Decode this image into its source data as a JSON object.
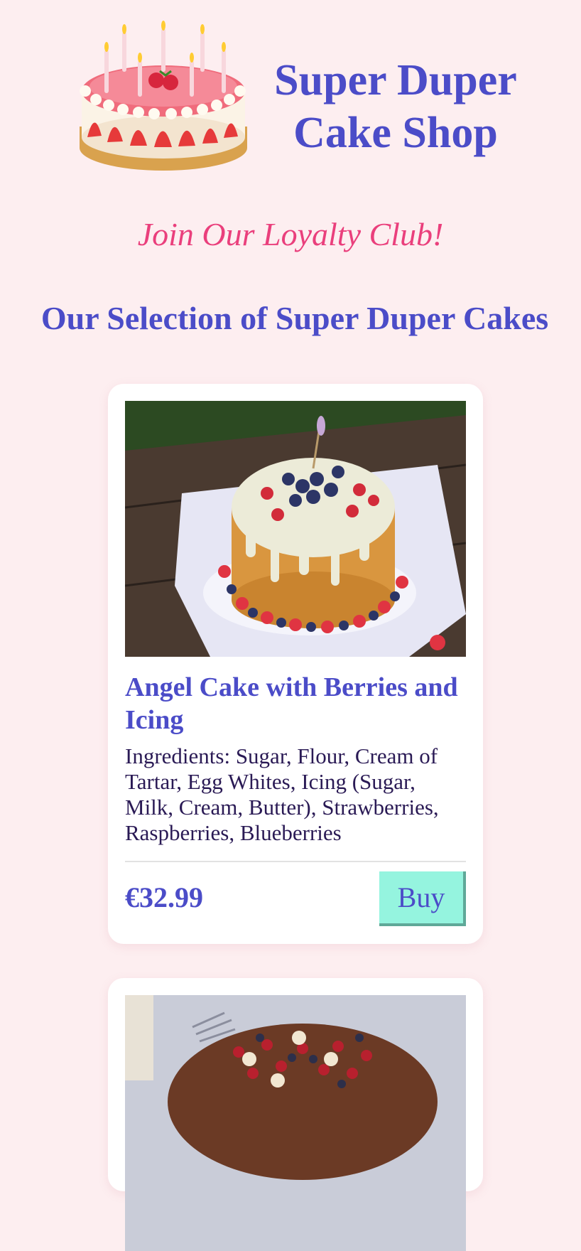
{
  "header": {
    "logo_icon": "birthday-cake-icon",
    "title": "Super Duper Cake Shop"
  },
  "loyalty_link": "Join Our Loyalty Club!",
  "section_title": "Our Selection of Super Duper Cakes",
  "products": [
    {
      "image": "angel-cake-photo",
      "name": "Angel Cake with Berries and Icing",
      "ingredients": "Ingredients: Sugar, Flour, Cream of Tartar, Egg Whites, Icing (Sugar, Milk, Cream, Butter), Strawberries, Raspberries, Blueberries",
      "price": "€32.99",
      "buy_label": "Buy"
    },
    {
      "image": "chocolate-berry-cake-photo"
    }
  ],
  "colors": {
    "background": "#fdeef0",
    "primary": "#4b4cc8",
    "accent": "#ea3f7c",
    "button": "#95f4df"
  }
}
